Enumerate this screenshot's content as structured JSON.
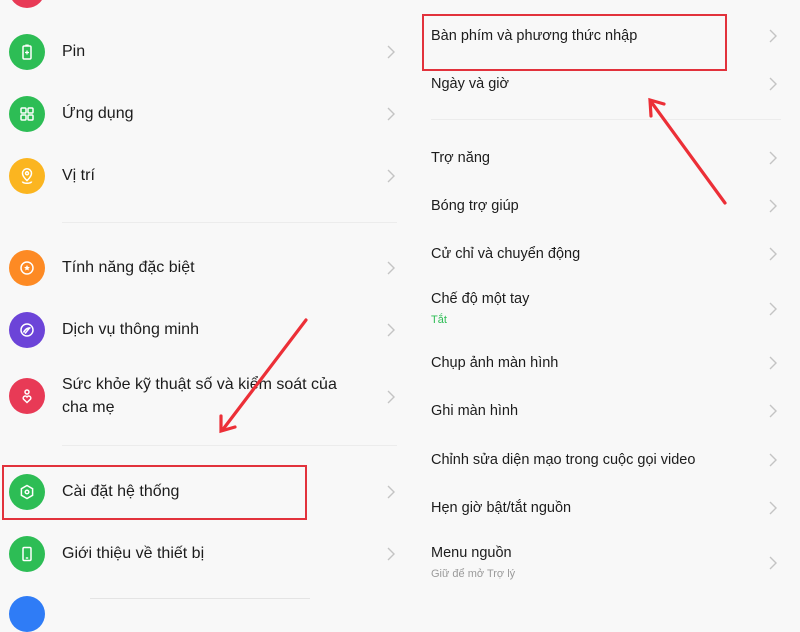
{
  "left_panel": {
    "items": [
      {
        "label": "Pin",
        "icon": "battery-icon",
        "color": "#2dbd55"
      },
      {
        "label": "Ứng dụng",
        "icon": "apps-grid-icon",
        "color": "#2dbd55"
      },
      {
        "label": "Vị trí",
        "icon": "location-pin-icon",
        "color": "#fbb520"
      },
      {
        "label": "Tính năng đặc biệt",
        "icon": "star-badge-icon",
        "color": "#fd8a24"
      },
      {
        "label": "Dịch vụ thông minh",
        "icon": "smart-service-icon",
        "color": "#6c44d8"
      },
      {
        "label": "Sức khỏe kỹ thuật số và kiểm soát của",
        "label_line2": "cha mẹ",
        "icon": "heart-person-icon",
        "color": "#e83a56"
      },
      {
        "label": "Cài đặt hệ thống",
        "icon": "settings-hex-icon",
        "color": "#2dbd55",
        "highlighted": true
      },
      {
        "label": "Giới thiệu về thiết bị",
        "icon": "phone-icon",
        "color": "#2dbd55"
      }
    ],
    "partial_top_icon_color": "#e83a56",
    "partial_bottom_icon_color": "#2f7cf6"
  },
  "right_panel": {
    "items": [
      {
        "label": "Bàn phím và phương thức nhập",
        "highlighted": true
      },
      {
        "label": "Ngày và giờ"
      },
      {
        "label": "Trợ năng"
      },
      {
        "label": "Bóng trợ giúp"
      },
      {
        "label": "Cử chỉ và chuyển động"
      },
      {
        "label": "Chế độ một tay",
        "sublabel": "Tắt",
        "sublabel_color": "#2dbd55"
      },
      {
        "label": "Chụp ảnh màn hình"
      },
      {
        "label": "Ghi màn hình"
      },
      {
        "label": "Chỉnh sửa diện mạo trong cuộc gọi video"
      },
      {
        "label": "Hẹn giờ bật/tắt nguồn"
      },
      {
        "label": "Menu nguồn",
        "sublabel": "Giữ để mở Trợ lý",
        "sublabel_color": "#9a9a9a"
      }
    ]
  },
  "annotation": {
    "highlight_color": "#e2323c"
  }
}
